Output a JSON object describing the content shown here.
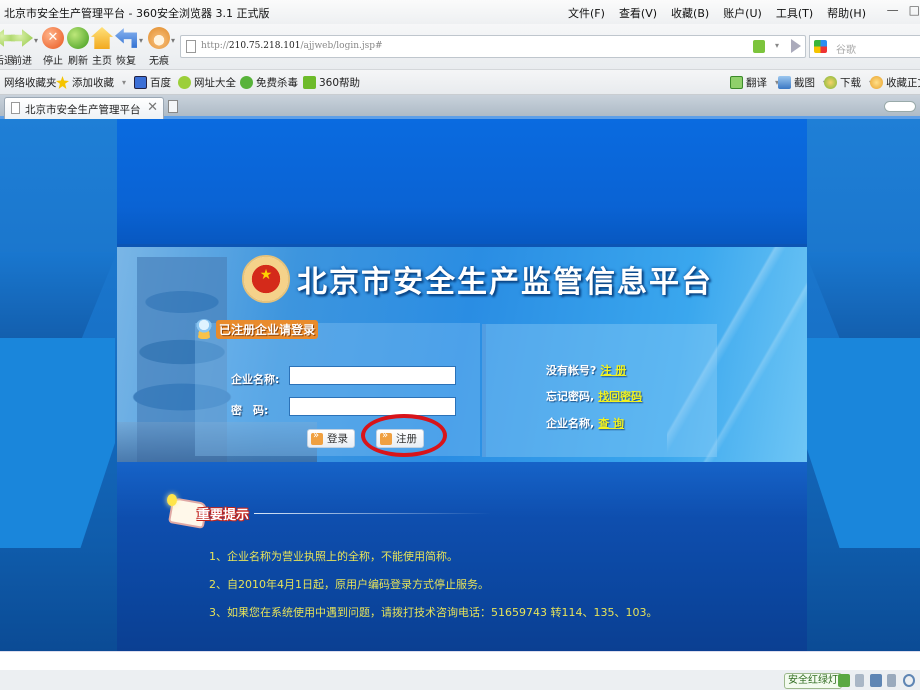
{
  "window": {
    "title": "北京市安全生产管理平台 - 360安全浏览器 3.1 正式版",
    "menu": [
      "文件(F)",
      "查看(V)",
      "收藏(B)",
      "账户(U)",
      "工具(T)",
      "帮助(H)"
    ],
    "controls": {
      "minimize": "—",
      "restore": "□"
    }
  },
  "navbar": {
    "buttons": [
      {
        "id": "back",
        "label": "后退",
        "icon": "back-arrow-icon"
      },
      {
        "id": "forward",
        "label": "前进",
        "icon": "forward-arrow-icon"
      },
      {
        "id": "stop",
        "label": "停止",
        "icon": "stop-icon"
      },
      {
        "id": "refresh",
        "label": "刷新",
        "icon": "refresh-icon"
      },
      {
        "id": "home",
        "label": "主页",
        "icon": "home-icon"
      },
      {
        "id": "restore",
        "label": "恢复",
        "icon": "undo-icon"
      },
      {
        "id": "incognito",
        "label": "无痕",
        "icon": "paw-icon"
      }
    ],
    "address": {
      "scheme": "http://",
      "host": "210.75.218.101",
      "path": "/ajjweb/login.jsp#"
    },
    "search_placeholder": "谷歌"
  },
  "favorites": {
    "left": [
      {
        "label": "网络收藏夹",
        "icon": ""
      },
      {
        "label": "添加收藏",
        "icon": "star-add-icon",
        "dropdown": true
      },
      {
        "label": "百度",
        "icon": "baidu-icon"
      },
      {
        "label": "网址大全",
        "icon": "web-directory-icon"
      },
      {
        "label": "免费杀毒",
        "icon": "antivirus-icon"
      },
      {
        "label": "360帮助",
        "icon": "help-icon"
      }
    ],
    "right": [
      {
        "label": "翻译",
        "icon": "translate-icon"
      },
      {
        "label": "截图",
        "icon": "screenshot-icon"
      },
      {
        "label": "下载",
        "icon": "download-icon"
      },
      {
        "label": "收藏正文",
        "icon": "bookmark-text-icon"
      }
    ]
  },
  "tabs": [
    {
      "label": "北京市安全生产管理平台",
      "active": true
    }
  ],
  "page": {
    "site_title": "北京市安全生产监管信息平台",
    "login": {
      "heading": "已注册企业请登录",
      "company_label": "企业名称:",
      "company_value": "",
      "password_label": "密　码:",
      "password_value": "",
      "login_button": "登录",
      "register_button": "注册"
    },
    "links": [
      {
        "prefix": "没有帐号?",
        "link": "注 册"
      },
      {
        "prefix": "忘记密码,",
        "link": "找回密码"
      },
      {
        "prefix": "企业名称,",
        "link": "查 询"
      }
    ],
    "notice": {
      "heading": "重要提示",
      "items": [
        "1、企业名称为营业执照上的全称，不能使用简称。",
        "2、自2010年4月1日起，原用户编码登录方式停止服务。",
        "3、如果您在系统使用中遇到问题，请拨打技术咨询电话：51659743 转114、135、103。"
      ]
    },
    "colors": {
      "link_yellow": "#f2f21f",
      "notice_text": "#e6e35a",
      "annotation_red": "#d8141a",
      "page_blue": "#0a63d4"
    }
  },
  "statusbar": {
    "badge": "安全红绿灯",
    "icons": [
      "security-shield-icon",
      "network-icon",
      "window-icon",
      "volume-icon",
      "zoom-icon"
    ]
  }
}
